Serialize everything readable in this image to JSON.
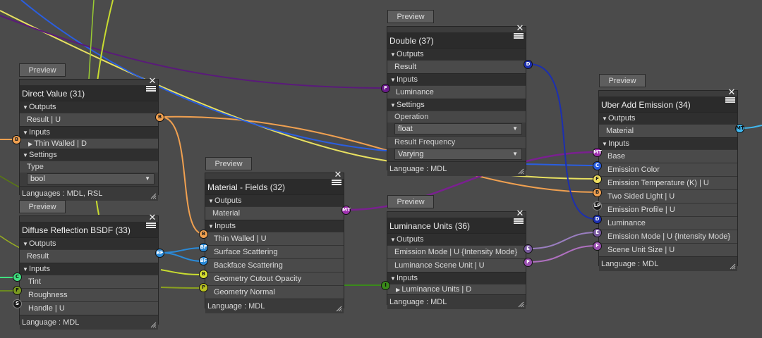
{
  "preview_label": "Preview",
  "close_glyph": "✕",
  "nodes": {
    "direct_value": {
      "title": "Direct Value (31)",
      "outputs": "Outputs",
      "result": "Result  | U",
      "inputs": "Inputs",
      "thin_walled": "Thin Walled  | D",
      "settings": "Settings",
      "type_label": "Type",
      "type_value": "bool",
      "footer": "Languages : MDL, RSL"
    },
    "diffuse": {
      "title": "Diffuse Reflection BSDF (33)",
      "outputs": "Outputs",
      "result": "Result",
      "inputs": "Inputs",
      "tint": "Tint",
      "roughness": "Roughness",
      "handle": "Handle  | U",
      "footer": "Language : MDL"
    },
    "material_fields": {
      "title": "Material - Fields (32)",
      "outputs": "Outputs",
      "material": "Material",
      "inputs": "Inputs",
      "thin_walled": "Thin Walled  | U",
      "surface_scattering": "Surface Scattering",
      "backface_scattering": "Backface Scattering",
      "geometry_cutout": "Geometry Cutout Opacity",
      "geometry_normal": "Geometry Normal",
      "footer": "Language : MDL"
    },
    "double": {
      "title": "Double (37)",
      "outputs": "Outputs",
      "result": "Result",
      "inputs": "Inputs",
      "luminance": "Luminance",
      "settings": "Settings",
      "operation_label": "Operation",
      "operation_value": "float",
      "frequency_label": "Result Frequency",
      "frequency_value": "Varying",
      "footer": "Language : MDL"
    },
    "luminance_units": {
      "title": "Luminance Units (36)",
      "outputs": "Outputs",
      "emission_mode": "Emission Mode  | U {Intensity Mode}",
      "luminance_scene_unit": "Luminance Scene Unit  | U",
      "inputs": "Inputs",
      "luminance_units": "Luminance Units  | D",
      "footer": "Language : MDL"
    },
    "uber_add_emission": {
      "title": "Uber Add Emission (34)",
      "outputs": "Outputs",
      "material": "Material",
      "inputs": "Inputs",
      "base": "Base",
      "emission_color": "Emission Color",
      "emission_temperature": "Emission Temperature (K)  | U",
      "two_sided_light": "Two Sided Light  | U",
      "emission_profile": "Emission Profile  | U",
      "luminance": "Luminance",
      "emission_mode": "Emission Mode  | U {Intensity Mode}",
      "scene_unit_size": "Scene Unit Size  | U",
      "footer": "Language : MDL"
    }
  },
  "port_letters": {
    "B": "B",
    "BF": "BF",
    "MT": "MT",
    "D": "D",
    "F": "F",
    "C": "C",
    "S": "S",
    "P": "P",
    "I": "I",
    "E": "E",
    "LP": "LP"
  },
  "colors": {
    "canvas": "#4b4b4b",
    "wire_orange": "#f0a050",
    "wire_yellow": "#e8e060",
    "wire_lime": "#c8dc30",
    "wire_blue": "#2a5ee0",
    "wire_navy": "#1c2fb0",
    "wire_purple": "#5a1a7a",
    "wire_violet": "#7a2090",
    "wire_lilac": "#9a7ec0",
    "wire_cyan": "#40b8f0",
    "wire_green": "#3a8a1a"
  }
}
